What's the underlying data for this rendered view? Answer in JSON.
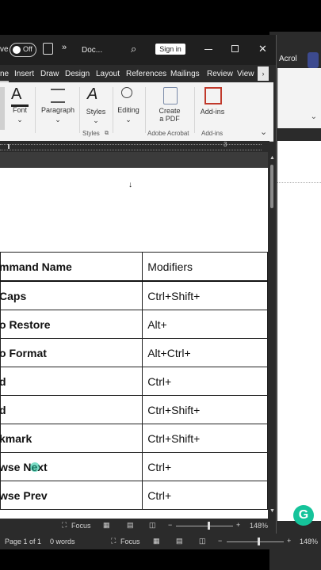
{
  "titlebar": {
    "autosave_label": "ve",
    "autosave_state": "Off",
    "doc_title": "Doc...",
    "signin_label": "Sign in"
  },
  "tabs": [
    "ne",
    "Insert",
    "Draw",
    "Design",
    "Layout",
    "References",
    "Mailings",
    "Review",
    "View"
  ],
  "back_window": {
    "tab": "Acrol"
  },
  "ribbon": {
    "font_label": "Font",
    "paragraph_label": "Paragraph",
    "styles_label": "Styles",
    "editing_label": "Editing",
    "create_pdf_label": "Create\na PDF",
    "addins_label": "Add-ins",
    "group_styles": "Styles",
    "group_adobe": "Adobe Acrobat",
    "group_addins": "Add-ins"
  },
  "table": {
    "header": [
      "mmand Name",
      "Modifiers"
    ],
    "rows": [
      [
        "Caps",
        "Ctrl+Shift+"
      ],
      [
        "o Restore",
        "Alt+"
      ],
      [
        "o Format",
        "Alt+Ctrl+"
      ],
      [
        "d",
        "Ctrl+"
      ],
      [
        "d",
        "Ctrl+Shift+"
      ],
      [
        "kmark",
        "Ctrl+Shift+"
      ],
      [
        "wse Next",
        "Ctrl+"
      ],
      [
        "wse Prev",
        "Ctrl+"
      ]
    ]
  },
  "status": {
    "focus_label": "Focus",
    "zoom": "148%",
    "page_info": "Page 1 of 1",
    "word_count": "0 words"
  },
  "colors": {
    "grammarly": "#15c39a",
    "dark": "#2b2b2b"
  }
}
